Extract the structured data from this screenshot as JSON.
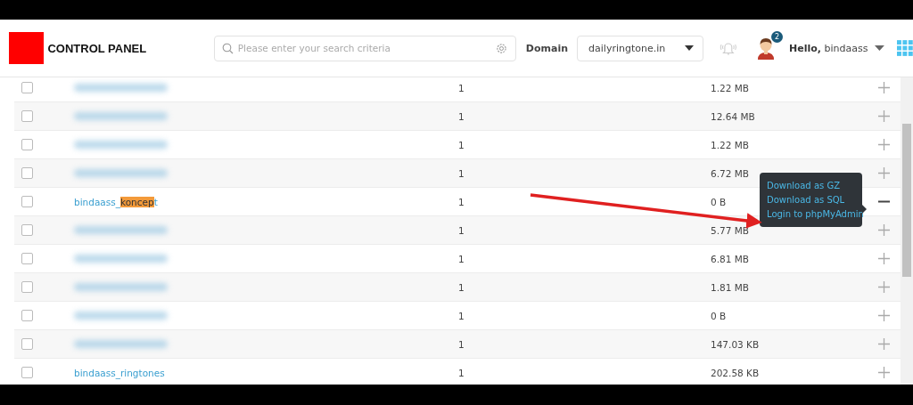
{
  "header": {
    "logo_text": "CONTROL PANEL",
    "search": {
      "placeholder": "Please enter your search criteria"
    },
    "domain_label": "Domain",
    "domain_value": "dailyringtone.in",
    "notification_count": "2",
    "greeting": "Hello,",
    "user": "bindaass"
  },
  "rows": [
    {
      "kind": "blurred",
      "checked": false,
      "count": "1",
      "size": "1.22 MB",
      "expanded": false
    },
    {
      "kind": "blurred",
      "checked": false,
      "count": "1",
      "size": "12.64 MB",
      "expanded": false
    },
    {
      "kind": "blurred",
      "checked": false,
      "count": "1",
      "size": "1.22 MB",
      "expanded": false
    },
    {
      "kind": "blurred",
      "checked": false,
      "count": "1",
      "size": "6.72 MB",
      "expanded": false
    },
    {
      "kind": "link",
      "name_parts": [
        {
          "text": "bindaass_",
          "highlight": false
        },
        {
          "text": "koncep",
          "highlight": true
        },
        {
          "text": "t",
          "highlight": false
        }
      ],
      "checked": false,
      "count": "1",
      "size": "0 B",
      "expanded": true,
      "menu": [
        "Download as GZ",
        "Download as SQL",
        "Login to phpMyAdmin"
      ]
    },
    {
      "kind": "blurred",
      "checked": false,
      "count": "1",
      "size": "5.77 MB",
      "expanded": false
    },
    {
      "kind": "blurred",
      "checked": false,
      "count": "1",
      "size": "6.81 MB",
      "expanded": false
    },
    {
      "kind": "blurred",
      "checked": false,
      "count": "1",
      "size": "1.81 MB",
      "expanded": false
    },
    {
      "kind": "blurred",
      "checked": false,
      "count": "1",
      "size": "0 B",
      "expanded": false
    },
    {
      "kind": "blurred",
      "checked": false,
      "count": "1",
      "size": "147.03 KB",
      "expanded": false
    },
    {
      "kind": "link",
      "name_parts": [
        {
          "text": "bindaass_ringtones",
          "highlight": false
        }
      ],
      "checked": false,
      "count": "1",
      "size": "202.58 KB",
      "expanded": false
    }
  ]
}
